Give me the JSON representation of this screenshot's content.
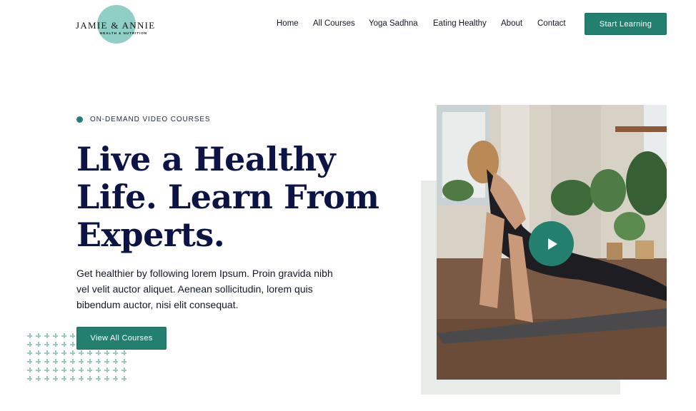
{
  "brand": {
    "name": "JAMIE & ANNIE",
    "tagline": "HEALTH & NUTRITION"
  },
  "nav": {
    "items": [
      "Home",
      "All Courses",
      "Yoga Sadhna",
      "Eating Healthy",
      "About",
      "Contact"
    ],
    "cta": "Start Learning"
  },
  "hero": {
    "eyebrow": "ON-DEMAND VIDEO COURSES",
    "headline": [
      "Live a Healthy",
      "Life. Learn From",
      "Experts."
    ],
    "paragraph_lines": [
      "Get healthier by following lorem Ipsum. Proin gravida nibh",
      "vel velit auctor aliquet. Aenean sollicitudin, lorem quis",
      "bibendum auctor, nisi elit consequat."
    ],
    "cta": "View All Courses",
    "media": {
      "icon": "play-icon"
    }
  },
  "colors": {
    "accent": "#23806f",
    "logo_circle": "#8fcfc6",
    "headline": "#0c1446",
    "block": "#e7ece9"
  }
}
